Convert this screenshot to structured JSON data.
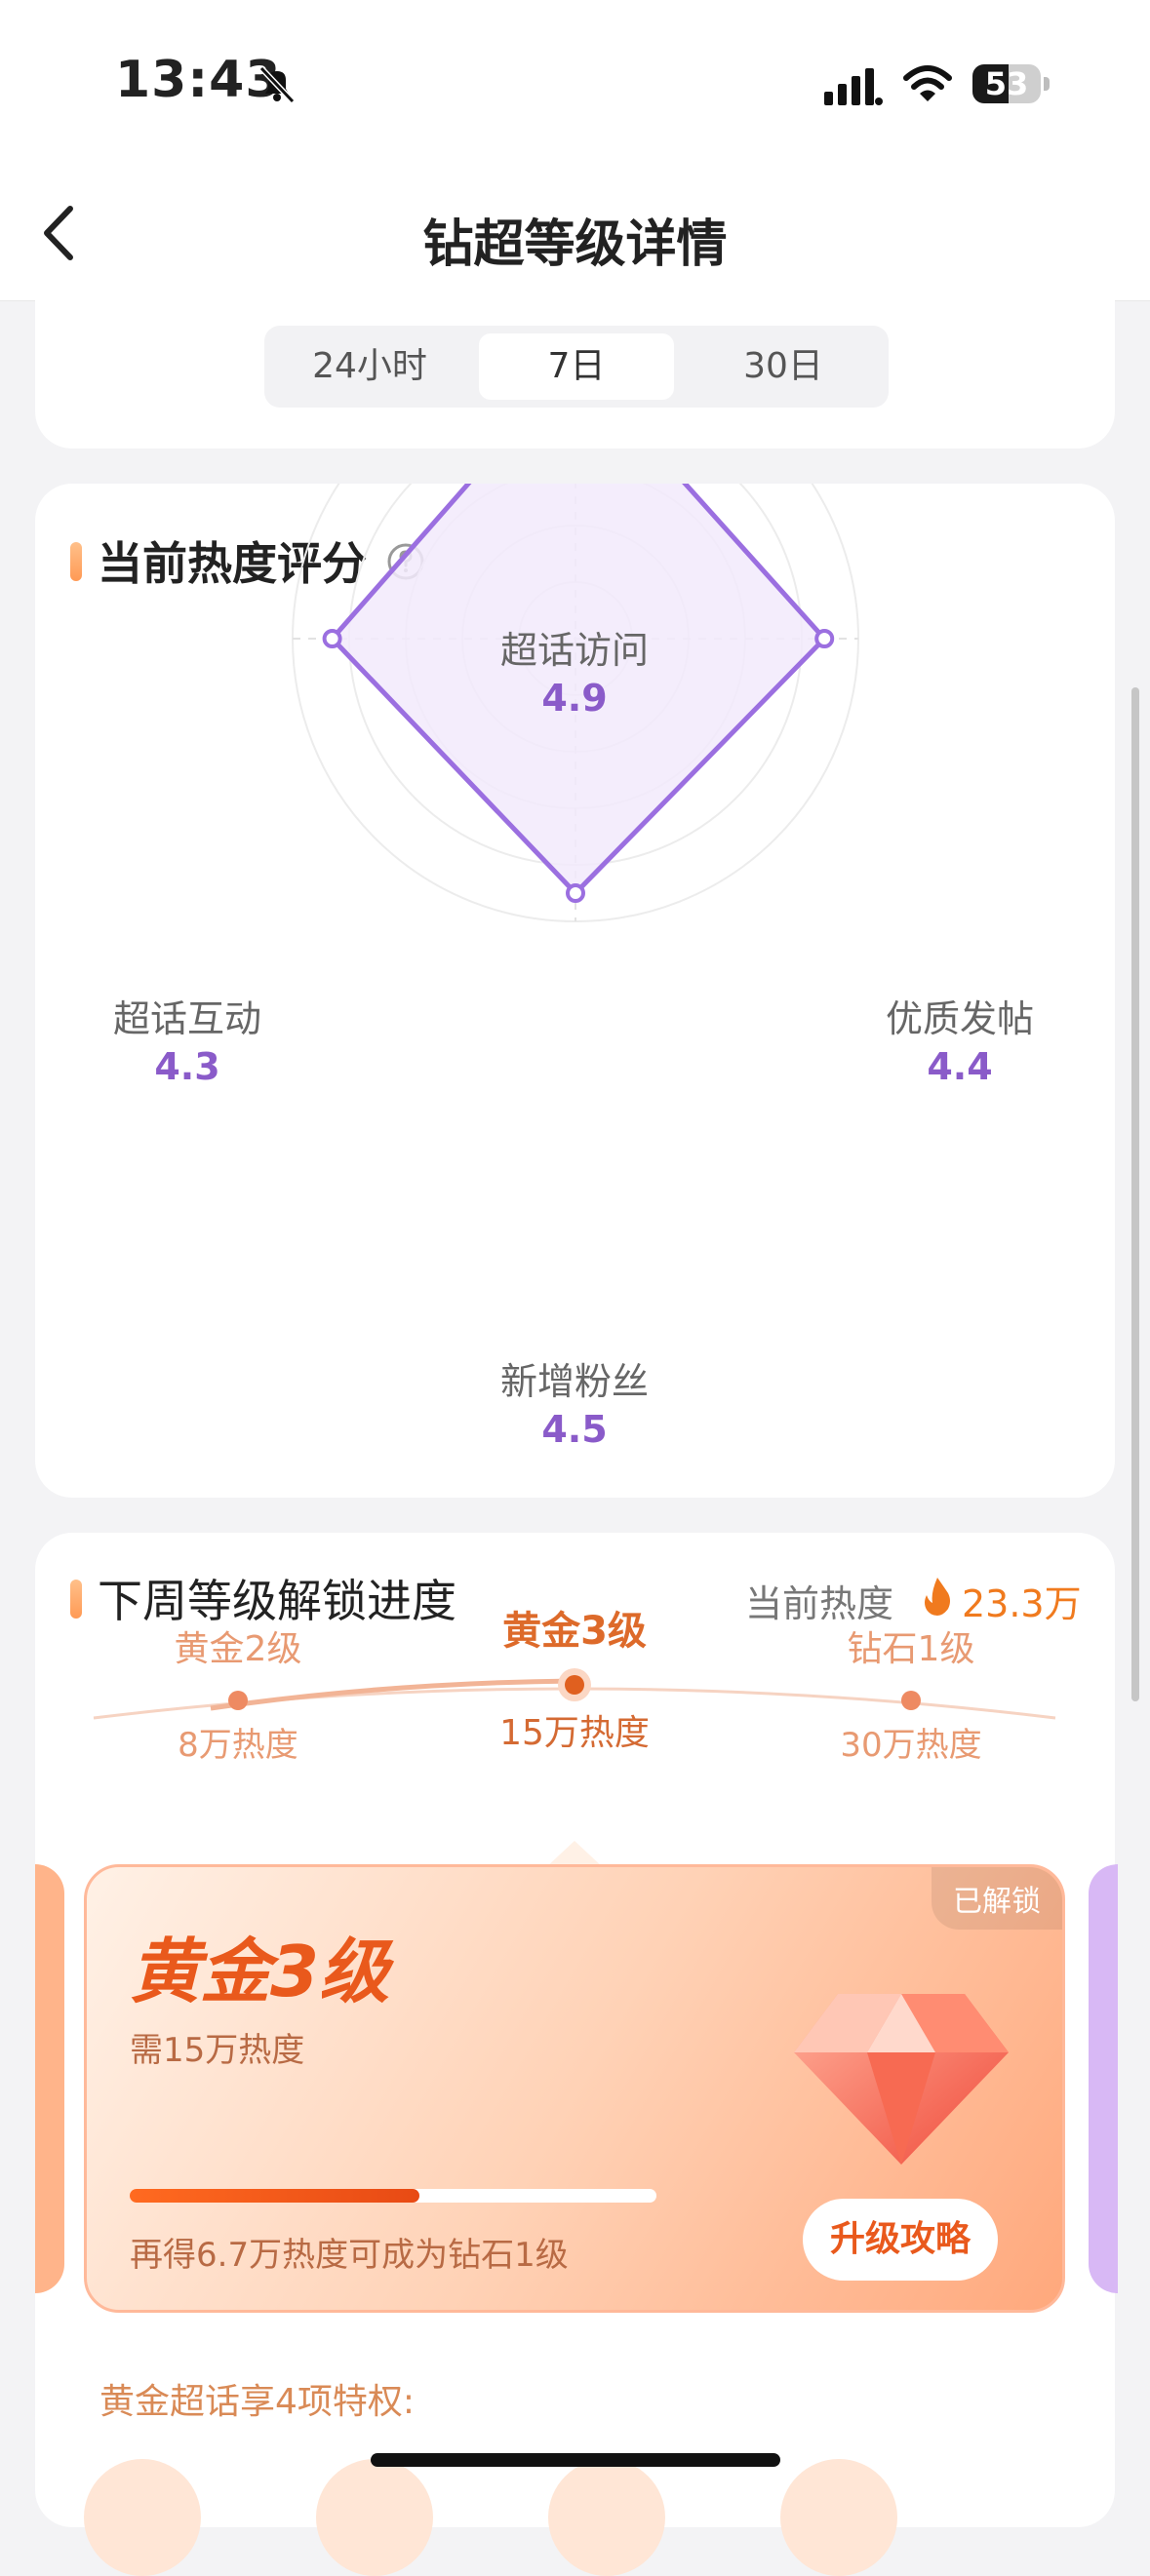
{
  "status": {
    "time": "13:43",
    "battery": "53",
    "battery_level": 0.53
  },
  "nav": {
    "title": "钻超等级详情"
  },
  "range_tabs": [
    {
      "label": "24小时",
      "active": false
    },
    {
      "label": "7日",
      "active": true
    },
    {
      "label": "30日",
      "active": false
    }
  ],
  "radar": {
    "title": "当前热度评分",
    "axes": [
      {
        "label": "超话访问",
        "value": "4.9"
      },
      {
        "label": "优质发帖",
        "value": "4.4"
      },
      {
        "label": "新增粉丝",
        "value": "4.5"
      },
      {
        "label": "超话互动",
        "value": "4.3"
      }
    ]
  },
  "chart_data": {
    "type": "radar",
    "title": "当前热度评分",
    "categories": [
      "超话访问",
      "优质发帖",
      "新增粉丝",
      "超话互动"
    ],
    "values": [
      4.9,
      4.4,
      4.5,
      4.3
    ],
    "range": [
      0,
      5
    ],
    "grid": true,
    "colors": {
      "line": "#9b6fe0",
      "fill": "#f2eafc"
    }
  },
  "unlock": {
    "title": "下周等级解锁进度",
    "current_heat_label": "当前热度",
    "current_heat_value": "23.3万",
    "levels": [
      {
        "name": "黄金2级",
        "heat": "8万热度"
      },
      {
        "name": "黄金3级",
        "heat": "15万热度"
      },
      {
        "name": "钻石1级",
        "heat": "30万热度"
      }
    ],
    "card": {
      "tag": "已解锁",
      "level": "黄金3级",
      "need": "需15万热度",
      "progress": 0.55,
      "progress_text": "再得6.7万热度可成为钻石1级",
      "button": "升级攻略"
    },
    "perk_text": "黄金超话享4项特权:"
  },
  "colors": {
    "accent": "#e9591c",
    "radar": "#9b6fe0"
  }
}
